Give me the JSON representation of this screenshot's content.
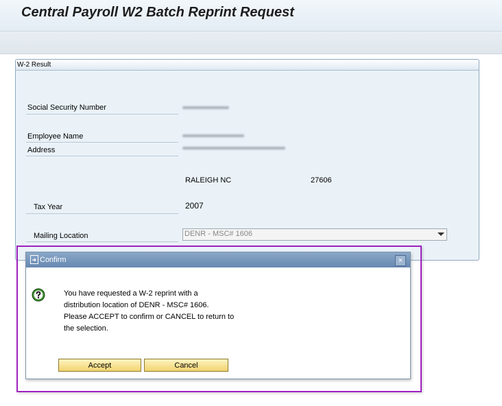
{
  "page": {
    "title": "Central Payroll W2 Batch Reprint Request"
  },
  "result": {
    "group_title": "W-2 Result",
    "fields": {
      "ssn_label": "Social Security Number",
      "employee_name_label": "Employee Name",
      "address_label": "Address",
      "city_state": "RALEIGH NC",
      "zip": "27606",
      "tax_year_label": "Tax Year",
      "tax_year_value": "2007",
      "mailing_location_label": "Mailing Location"
    },
    "mailing_location_select": {
      "selected": "DENR - MSC# 1606"
    }
  },
  "dialog": {
    "title": "Confirm",
    "close_glyph": "×",
    "message_lines": [
      "You have requested a W-2 reprint with a",
      "distribution location of DENR - MSC# 1606.",
      "Please ACCEPT to confirm or CANCEL to return to",
      "the selection."
    ],
    "accept_label": "Accept",
    "cancel_label": "Cancel"
  },
  "colors": {
    "highlight_border": "#a020c0",
    "button_fill": "#f1d36f",
    "dialog_header": "#6788b0",
    "question_icon": "#3a8a2a"
  }
}
